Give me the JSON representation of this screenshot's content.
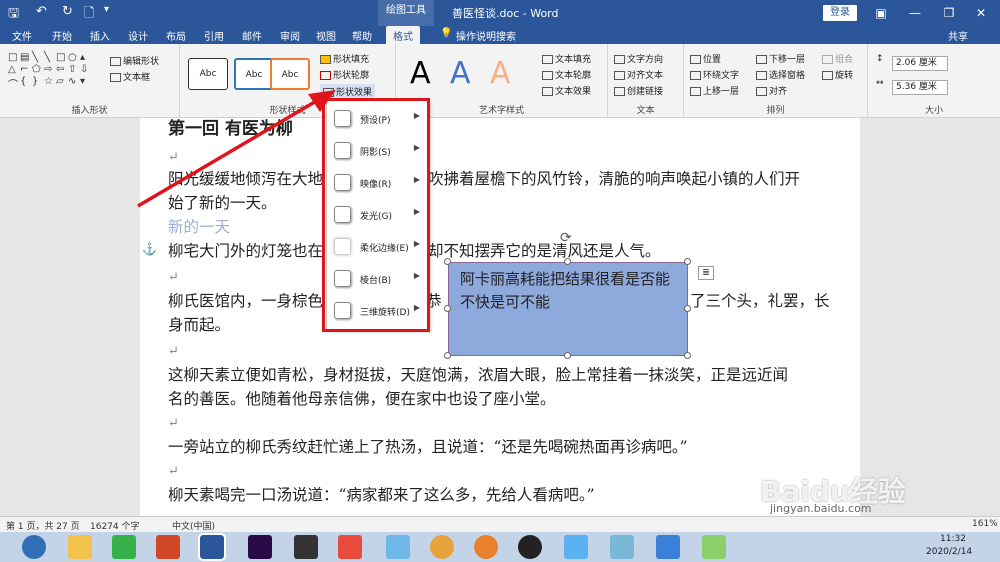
{
  "titlebar": {
    "context_group": "绘图工具",
    "doc_title": "善医怪谈.doc - Word",
    "login_label": "登录"
  },
  "tabs": [
    "文件",
    "开始",
    "插入",
    "设计",
    "布局",
    "引用",
    "邮件",
    "审阅",
    "视图",
    "帮助",
    "格式"
  ],
  "active_tab": "格式",
  "tell_me": "操作说明搜索",
  "share": "共享",
  "ribbon": {
    "insert_shapes": {
      "edit_shape": "编辑形状",
      "text_box": "文本框",
      "label": "插入形状"
    },
    "shape_styles": {
      "samples": [
        "Abc",
        "Abc",
        "Abc"
      ],
      "fill": "形状填充",
      "outline": "形状轮廓",
      "effects": "形状效果",
      "label": "形状样式"
    },
    "wordart": {
      "letters": [
        "A",
        "A",
        "A"
      ],
      "text_fill": "文本填充",
      "text_outline": "文本轮廓",
      "text_effects": "文本效果",
      "label": "艺术字样式"
    },
    "text": {
      "direction": "文字方向",
      "align": "对齐文本",
      "link": "创建链接",
      "label": "文本"
    },
    "arrange": {
      "position": "位置",
      "wrap": "环绕文字",
      "forward": "上移一层",
      "backward": "下移一层",
      "pane": "选择窗格",
      "align": "对齐",
      "group": "组合",
      "rotate": "旋转",
      "label": "排列"
    },
    "size": {
      "height": "2.06 厘米",
      "width": "5.36 厘米",
      "label": "大小"
    }
  },
  "effects_menu": [
    {
      "label": "预设(P)"
    },
    {
      "label": "阴影(S)"
    },
    {
      "label": "映像(R)"
    },
    {
      "label": "发光(G)"
    },
    {
      "label": "柔化边缘(E)"
    },
    {
      "label": "棱台(B)"
    },
    {
      "label": "三维旋转(D)"
    }
  ],
  "document": {
    "heading": "第一回 有医为柳",
    "p1a": "阳光缓缓地倾泻在大地",
    "p1b": "吹拂着屋檐下的风竹铃，清脆的响声唤起小镇的人们开",
    "p1c": "始了新的一天。",
    "faded": "新的一天",
    "p2a": "柳宅大门外的灯笼也在",
    "p2b": "却不知摆弄它的是清风还是人气。",
    "p3a": "柳氏医馆内，一身棕色",
    "p3b": "恭",
    "p3c": "了三个头，礼罢，长",
    "p3d": "身而起。",
    "p4a": "这柳天素立便如青松，身材挺拔，天庭饱满，浓眉大眼，脸上常挂着一抹淡笑，正是远近闻",
    "p4b": "名的善医。他随着他母亲信佛，便在家中也设了座小堂。",
    "p5": "一旁站立的柳氏秀纹赶忙递上了热汤，且说道：“还是先喝碗热面再诊病吧。”",
    "p6": "柳天素喝完一口汤说道：“病家都来了这么多，先给人看病吧。”",
    "mark": "↵"
  },
  "textbox_text": "阿卡丽高耗能把结果很看是否能不快是可不能",
  "status": {
    "page": "第 1 页，共 27 页",
    "words": "16274 个字",
    "lang": "中文(中国)",
    "zoom": "161%"
  },
  "clock": {
    "time": "11:32",
    "date": "2020/2/14"
  },
  "watermark": {
    "brand": "Baidu经验",
    "url": "jingyan.baidu.com"
  }
}
